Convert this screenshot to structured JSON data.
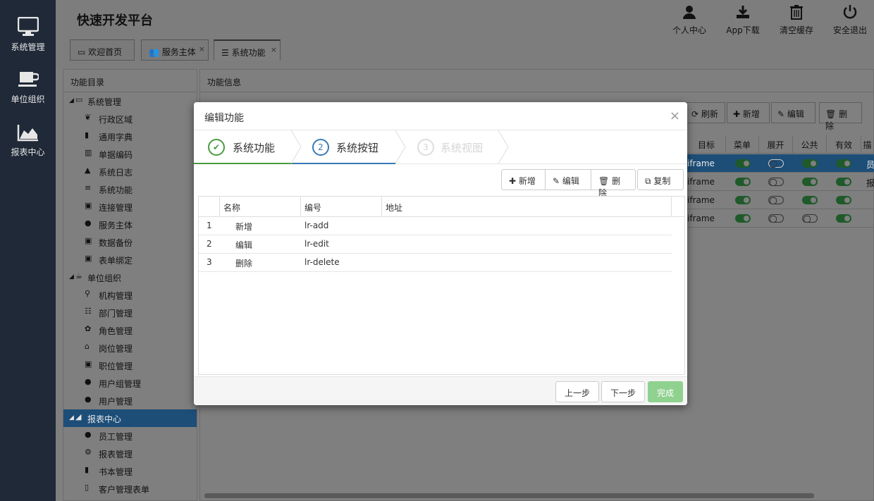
{
  "leftnav": {
    "items": [
      {
        "label": "系统管理",
        "icon": "monitor-icon"
      },
      {
        "label": "单位组织",
        "icon": "coffee-cup-icon"
      },
      {
        "label": "报表中心",
        "icon": "area-chart-icon"
      }
    ]
  },
  "header": {
    "brand": "快速开发平台",
    "buttons": [
      {
        "label": "个人中心",
        "icon": "user-icon"
      },
      {
        "label": "App下载",
        "icon": "download-icon"
      },
      {
        "label": "清空缓存",
        "icon": "trash-icon"
      },
      {
        "label": "安全退出",
        "icon": "power-icon"
      }
    ],
    "tabs": [
      {
        "label": "欢迎首页",
        "icon": "desktop-icon"
      },
      {
        "label": "服务主体",
        "icon": "users-icon"
      },
      {
        "label": "系统功能",
        "icon": "list-icon"
      }
    ]
  },
  "tree": {
    "title": "功能目录",
    "nodes": [
      {
        "label": "系统管理",
        "level": 0,
        "icon": "monitor-icon"
      },
      {
        "label": "行政区域",
        "level": 1,
        "icon": "leaf-icon"
      },
      {
        "label": "通用字典",
        "level": 1,
        "icon": "book-icon"
      },
      {
        "label": "单据编码",
        "level": 1,
        "icon": "barcode-icon"
      },
      {
        "label": "系统日志",
        "level": 1,
        "icon": "warning-icon"
      },
      {
        "label": "系统功能",
        "level": 1,
        "icon": "list-icon"
      },
      {
        "label": "连接管理",
        "level": 1,
        "icon": "briefcase-icon"
      },
      {
        "label": "服务主体",
        "level": 1,
        "icon": "users-icon"
      },
      {
        "label": "数据备份",
        "level": 1,
        "icon": "briefcase-icon"
      },
      {
        "label": "表单绑定",
        "level": 1,
        "icon": "briefcase-icon"
      },
      {
        "label": "单位组织",
        "level": 0,
        "icon": "coffee-cup-icon"
      },
      {
        "label": "机构管理",
        "level": 1,
        "icon": "sitemap-icon"
      },
      {
        "label": "部门管理",
        "level": 1,
        "icon": "th-list-icon"
      },
      {
        "label": "角色管理",
        "level": 1,
        "icon": "paw-icon"
      },
      {
        "label": "岗位管理",
        "level": 1,
        "icon": "graduation-cap-icon"
      },
      {
        "label": "职位管理",
        "level": 1,
        "icon": "briefcase-icon"
      },
      {
        "label": "用户组管理",
        "level": 1,
        "icon": "users-icon"
      },
      {
        "label": "用户管理",
        "level": 1,
        "icon": "user-icon"
      },
      {
        "label": "报表中心",
        "level": 0,
        "icon": "area-chart-icon"
      },
      {
        "label": "员工管理",
        "level": 1,
        "icon": "users-icon"
      },
      {
        "label": "报表管理",
        "level": 1,
        "icon": "cogs-icon"
      },
      {
        "label": "书本管理",
        "level": 1,
        "icon": "book-icon"
      },
      {
        "label": "客户管理表单",
        "level": 1,
        "icon": "file-icon"
      }
    ]
  },
  "infopanel": {
    "title": "功能信息",
    "toolbar": [
      "刷新",
      "新增",
      "编辑",
      "删除"
    ],
    "columns": [
      "目标",
      "菜单",
      "展开",
      "公共",
      "有效",
      "描"
    ],
    "rows": [
      {
        "target": "iframe",
        "menu": true,
        "expand": false,
        "public": true,
        "valid": true,
        "desc": "员"
      },
      {
        "target": "iframe",
        "menu": true,
        "expand": false,
        "public": true,
        "valid": true,
        "desc": "报"
      },
      {
        "target": "iframe",
        "menu": true,
        "expand": false,
        "public": true,
        "valid": true,
        "desc": ""
      },
      {
        "target": "iframe",
        "menu": true,
        "expand": false,
        "public": false,
        "valid": true,
        "desc": ""
      }
    ]
  },
  "modal": {
    "title": "编辑功能",
    "close": "×",
    "steps": [
      {
        "num": "✔",
        "label": "系统功能"
      },
      {
        "num": "2",
        "label": "系统按钮"
      },
      {
        "num": "3",
        "label": "系统视图"
      }
    ],
    "toolbar": {
      "add": "新增",
      "edit": "编辑",
      "delete": "删除",
      "copy": "复制"
    },
    "grid": {
      "headers": [
        "名称",
        "编号",
        "地址"
      ],
      "rows": [
        {
          "index": "1",
          "name": "新增",
          "code": "lr-add",
          "url": ""
        },
        {
          "index": "2",
          "name": "编辑",
          "code": "lr-edit",
          "url": ""
        },
        {
          "index": "3",
          "name": "删除",
          "code": "lr-delete",
          "url": ""
        }
      ]
    },
    "footer": {
      "prev": "上一步",
      "next": "下一步",
      "finish": "完成"
    }
  },
  "colors": {
    "nav_bg": "#1f2937",
    "selected": "#1d4e78",
    "step_done": "#4a9b3f",
    "step_active": "#3879b8",
    "finish_btn": "#8fd18f"
  }
}
